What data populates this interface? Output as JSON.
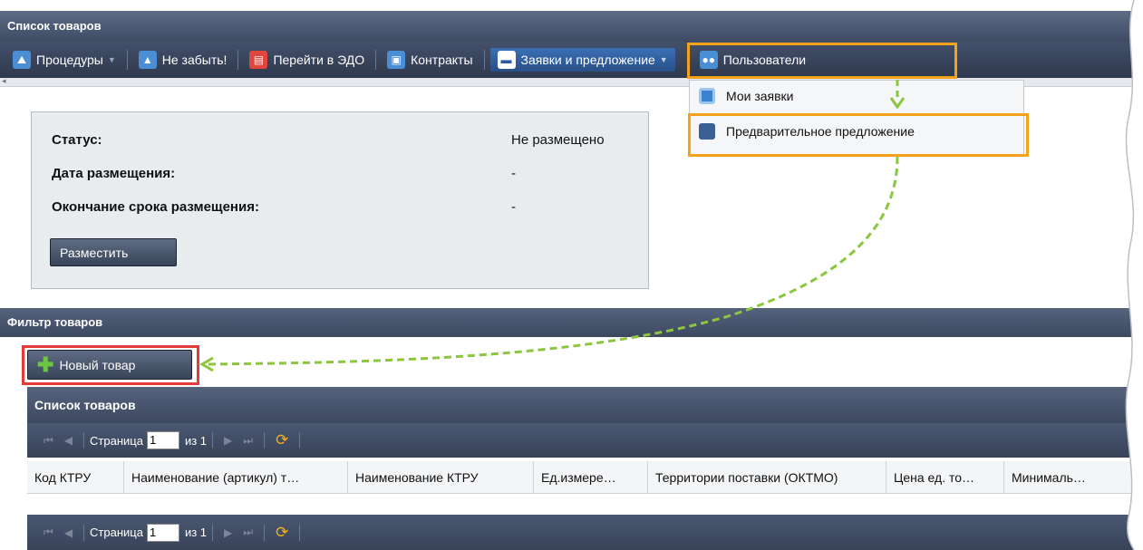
{
  "window": {
    "title": "Список товаров"
  },
  "toolbar": {
    "items": [
      {
        "label": "Процедуры",
        "icon": "procedures-icon",
        "has_dropdown": true
      },
      {
        "label": "Не забыть!",
        "icon": "reminder-icon",
        "has_dropdown": false
      },
      {
        "label": "Перейти в ЭДО",
        "icon": "edo-icon",
        "has_dropdown": false
      },
      {
        "label": "Контракты",
        "icon": "contracts-icon",
        "has_dropdown": false
      },
      {
        "label": "Заявки и предложение",
        "icon": "folder-icon",
        "has_dropdown": true
      },
      {
        "label": "Пользователи",
        "icon": "users-icon",
        "has_dropdown": false
      }
    ]
  },
  "dropdown": {
    "items": [
      {
        "label": "Мои заявки"
      },
      {
        "label": "Предварительное предложение"
      }
    ]
  },
  "status_panel": {
    "status_label": "Статус:",
    "status_value": "Не размещено",
    "date_label": "Дата размещения:",
    "date_value": "-",
    "end_label": "Окончание срока размещения:",
    "end_value": "-",
    "publish_button": "Разместить"
  },
  "filter": {
    "title": "Фильтр товаров",
    "new_product_button": "Новый товар"
  },
  "product_list": {
    "title": "Список товаров",
    "pager": {
      "page_label": "Страница",
      "page_value": "1",
      "of_label": "из 1"
    },
    "columns": [
      "Код КТРУ",
      "Наименование (артикул) т…",
      "Наименование КТРУ",
      "Ед.измере…",
      "Территории поставки (ОКТМО)",
      "Цена ед. то…",
      "Минималь…"
    ]
  },
  "colors": {
    "highlight_orange": "#f3a21a",
    "highlight_red": "#e53a3a",
    "arrow_green": "#8cc63f",
    "header_dark": "#3f4b63"
  }
}
